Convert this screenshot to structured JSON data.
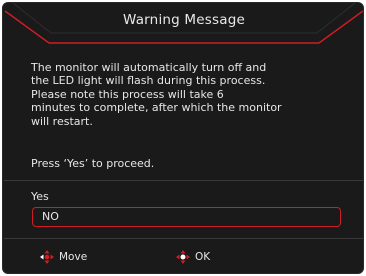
{
  "dialog": {
    "title": "Warning Message",
    "message_lines": [
      "The monitor will automatically turn off and",
      "the LED light will flash during this process.",
      "Please note this process will take 6",
      "minutes to complete, after which the monitor",
      "will restart."
    ],
    "prompt": "Press ‘Yes’ to proceed.",
    "options": [
      {
        "label": "Yes",
        "selected": false
      },
      {
        "label": "NO",
        "selected": true
      }
    ]
  },
  "footer": {
    "move_label": "Move",
    "move_icon": "dpad-left-icon",
    "ok_label": "OK",
    "ok_icon": "dpad-center-icon"
  },
  "colors": {
    "background": "#1a1a1a",
    "accent": "#d01c24",
    "text": "#e6e6e6",
    "divider": "#3a3a3a"
  }
}
